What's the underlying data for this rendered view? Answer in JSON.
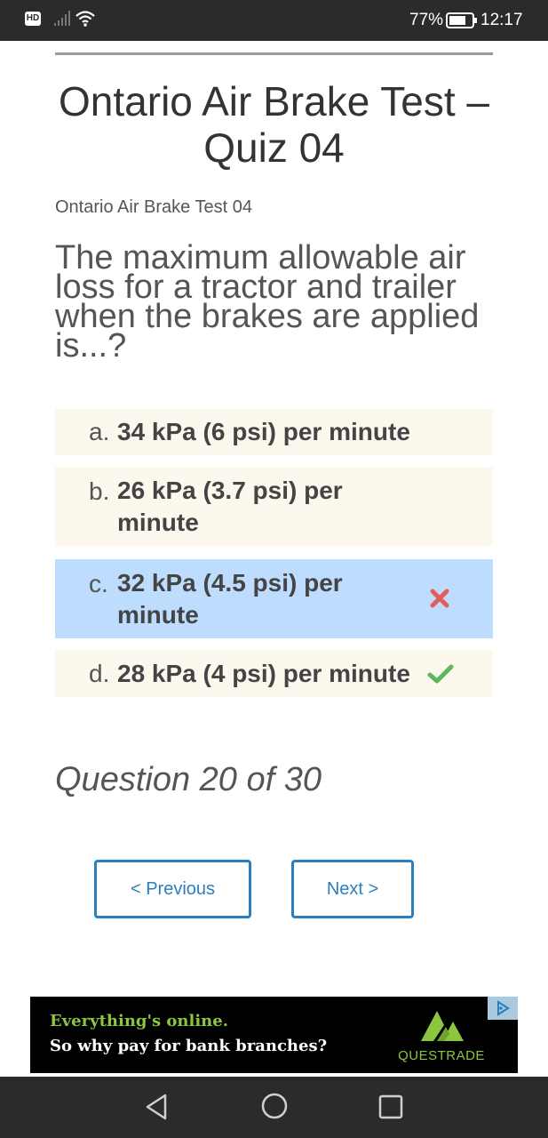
{
  "status_bar": {
    "hd_badge": "HD",
    "battery_percent": "77%",
    "time": "12:17"
  },
  "page": {
    "title": "Ontario Air Brake Test – Quiz 04",
    "subtitle": "Ontario Air Brake Test 04",
    "question": "The maximum allowable air loss for a tractor and trailer when the brakes are applied is...?",
    "answers": [
      {
        "letter": "a.",
        "text": "34 kPa (6 psi) per minute",
        "state": "normal"
      },
      {
        "letter": "b.",
        "text": "26 kPa (3.7 psi) per minute",
        "state": "normal"
      },
      {
        "letter": "c.",
        "text": "32 kPa (4.5 psi) per minute",
        "state": "selected-wrong"
      },
      {
        "letter": "d.",
        "text": "28 kPa (4 psi) per minute",
        "state": "correct"
      }
    ],
    "progress_text": "Question 20 of 30",
    "previous_label": "< Previous",
    "next_label": "Next >"
  },
  "ad": {
    "line1": "Everything's online.",
    "line2": "So why pay for bank branches?",
    "brand": "QUESTRADE"
  },
  "colors": {
    "accent": "#2a7fc0",
    "answer_bg": "#fdf8ed",
    "selected_bg": "#bedcfd",
    "wrong": "#e45c5c",
    "correct": "#5cb85c"
  },
  "icons": {
    "wrong_mark": "cross-mark-icon",
    "correct_mark": "check-mark-icon"
  }
}
